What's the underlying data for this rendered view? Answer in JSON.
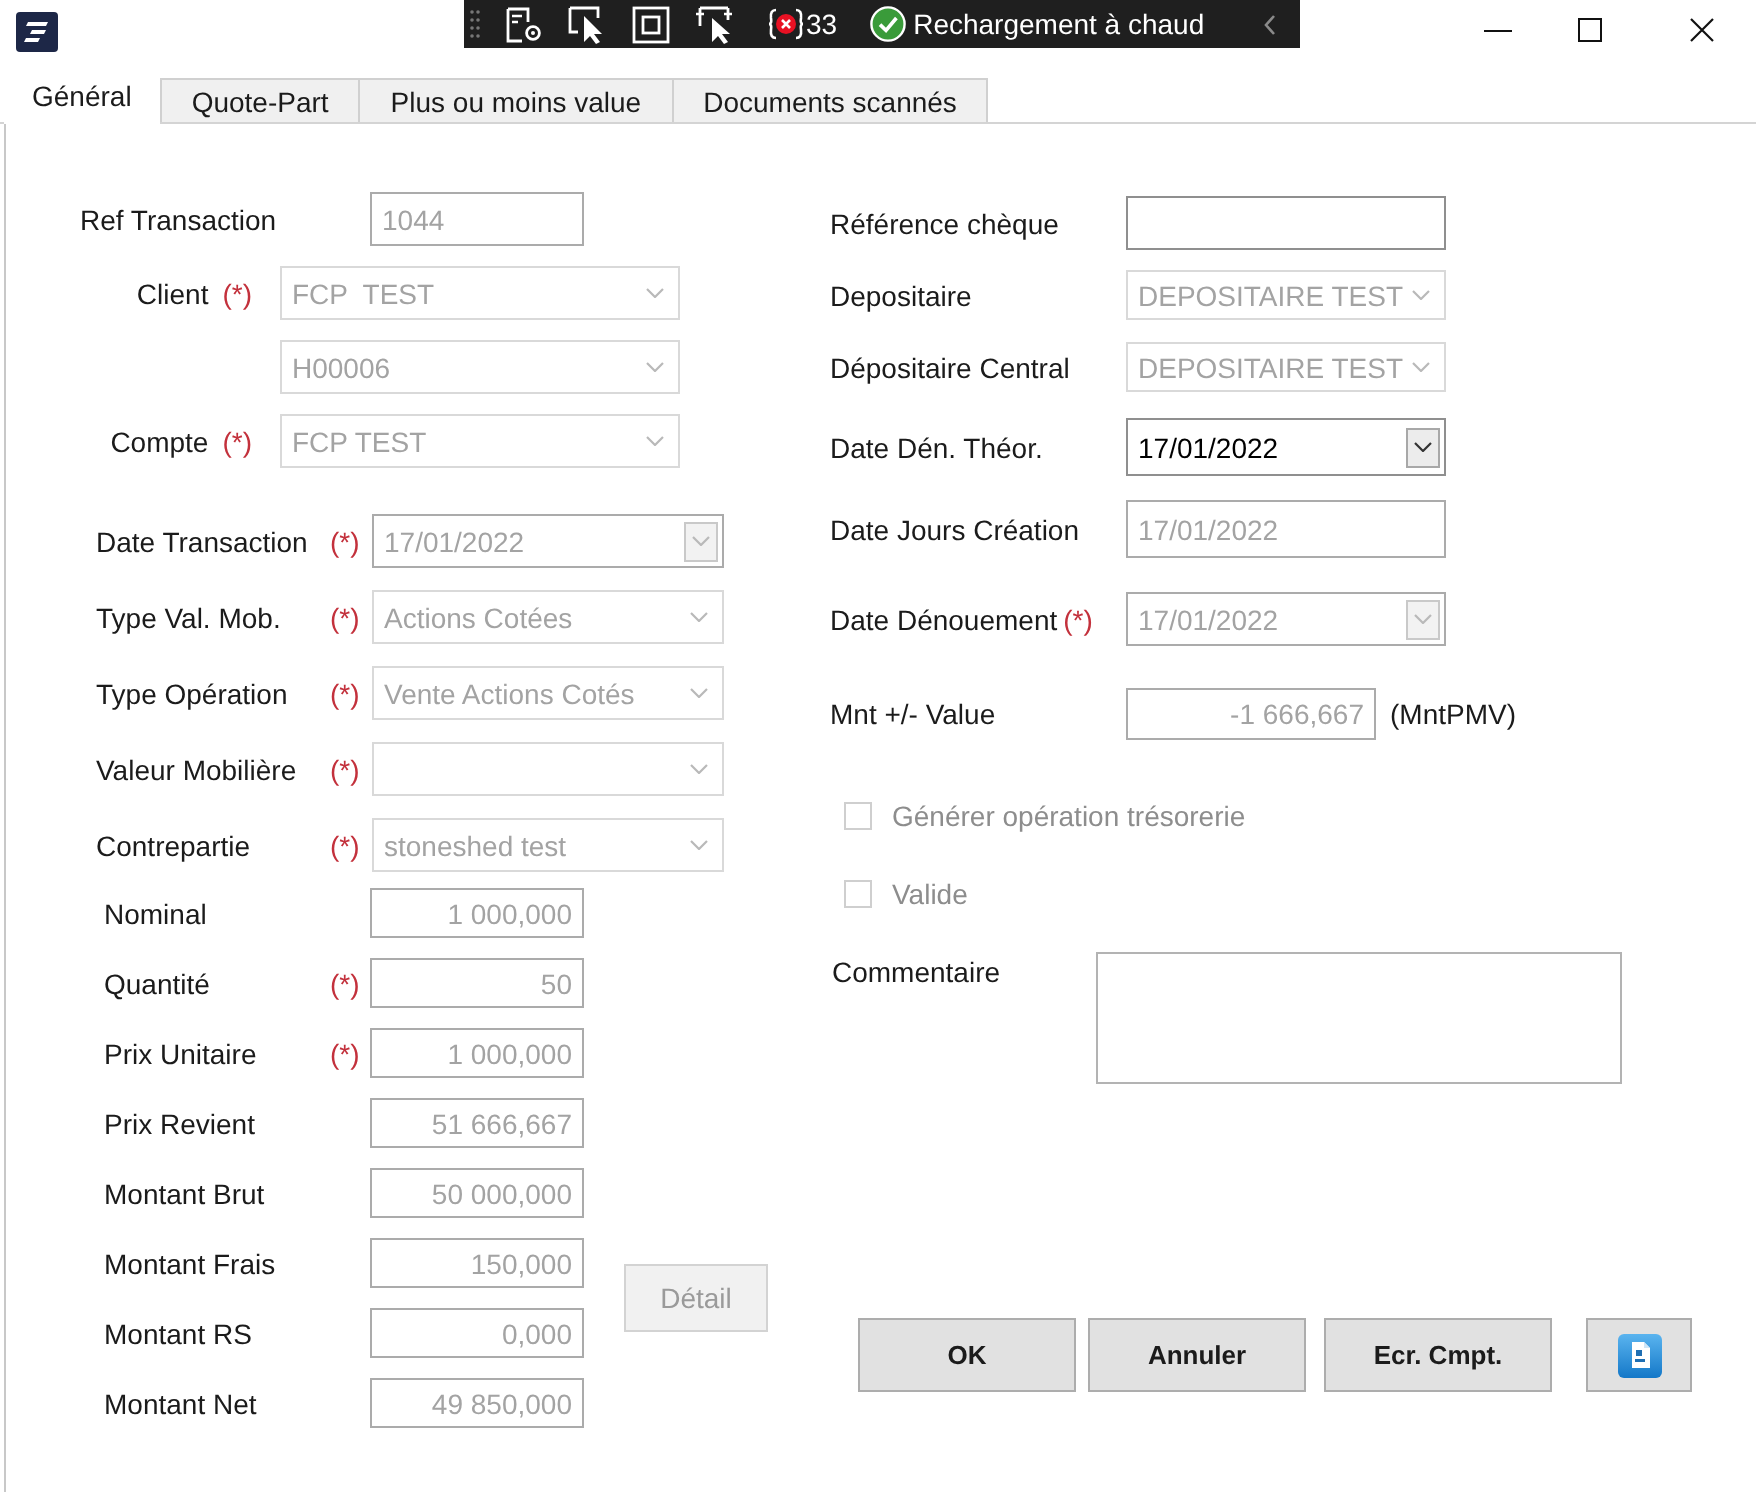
{
  "dev_toolbar": {
    "error_count": "33",
    "hot_reload": "Rechargement à chaud"
  },
  "tabs": [
    {
      "label": "Général",
      "selected": true
    },
    {
      "label": "Quote-Part",
      "selected": false
    },
    {
      "label": "Plus ou moins value",
      "selected": false
    },
    {
      "label": "Documents scannés",
      "selected": false
    }
  ],
  "general": {
    "account_fields": [
      {
        "label": "Ref Transaction",
        "kind": "text",
        "value": "1044",
        "disabled": true
      },
      {
        "label": "Client",
        "mark": "(*)",
        "kind": "combo",
        "value": "FCP  TEST",
        "disabled": true
      },
      {
        "kind": "combo",
        "value": "H00006",
        "disabled": true
      },
      {
        "label": "Compte",
        "mark": "(*)",
        "kind": "combo",
        "value": "FCP TEST",
        "disabled": true
      }
    ],
    "security_fields": [
      {
        "label": "Date Transaction",
        "mark": "(*)",
        "kind": "date",
        "value": "17/01/2022",
        "disabled": true
      },
      {
        "label": "Type Val. Mob.",
        "mark": "(*)",
        "kind": "combo",
        "value": "Actions Cotées",
        "disabled": true
      },
      {
        "label": "Type Opération",
        "mark": "(*)",
        "kind": "combo",
        "value": "Vente Actions Cotés",
        "disabled": true
      },
      {
        "label": "Valeur Mobilière",
        "mark": "(*)",
        "kind": "combo",
        "disabled": true
      },
      {
        "label": "Contrepartie",
        "mark": "(*)",
        "kind": "combo",
        "value": "stoneshed test",
        "disabled": true
      }
    ],
    "amount_fields": [
      {
        "label": "Nominal",
        "kind": "number",
        "value": "1 000,000",
        "disabled": true
      },
      {
        "label": "Quantité",
        "mark": "(*)",
        "kind": "number",
        "value": "50",
        "disabled": true
      },
      {
        "label": "Prix Unitaire",
        "mark": "(*)",
        "kind": "number",
        "value": "1 000,000",
        "disabled": true
      },
      {
        "label": "Prix Revient",
        "kind": "number",
        "value": "51 666,667",
        "disabled": true
      },
      {
        "label": "Montant Brut",
        "kind": "number",
        "value": "50 000,000",
        "disabled": true
      },
      {
        "label": "Montant Frais",
        "kind": "number",
        "value": "150,000",
        "disabled": true
      },
      {
        "label": "Montant RS",
        "kind": "number",
        "value": "0,000",
        "disabled": true
      },
      {
        "label": "Montant Net",
        "kind": "number",
        "value": "49 850,000",
        "disabled": true
      }
    ],
    "detail_button": {
      "label": "Détail",
      "disabled": true
    },
    "settlement_fields": [
      {
        "label": "Référence chèque",
        "kind": "text",
        "disabled": false
      },
      {
        "label": "Depositaire",
        "kind": "combo",
        "value": "DEPOSITAIRE TEST",
        "disabled": true
      },
      {
        "label": "Dépositaire Central",
        "kind": "combo",
        "value": "DEPOSITAIRE TEST",
        "disabled": true
      },
      {
        "label": "Date Dén. Théor.",
        "kind": "date",
        "value": "17/01/2022",
        "disabled": false
      },
      {
        "label": "Date Jours Création",
        "kind": "text",
        "value": "17/01/2022",
        "disabled": true
      },
      {
        "label": "Date Dénouement",
        "mark": "(*)",
        "kind": "date",
        "value": "17/01/2022",
        "disabled": true
      },
      {
        "label": "Mnt +/- Value",
        "kind": "number",
        "value": "-1 666,667",
        "disabled": true,
        "suffix": "(MntPMV)"
      }
    ],
    "options": [
      {
        "label": "Générer opération trésorerie",
        "checked": false,
        "disabled": true
      },
      {
        "label": "Valide",
        "checked": false,
        "disabled": true
      }
    ],
    "comment": {
      "label": "Commentaire"
    },
    "buttons": [
      {
        "kind": "text",
        "label": "OK"
      },
      {
        "kind": "text",
        "label": "Annuler"
      },
      {
        "kind": "text",
        "label": "Ecr. Cmpt."
      },
      {
        "kind": "icon"
      }
    ]
  }
}
